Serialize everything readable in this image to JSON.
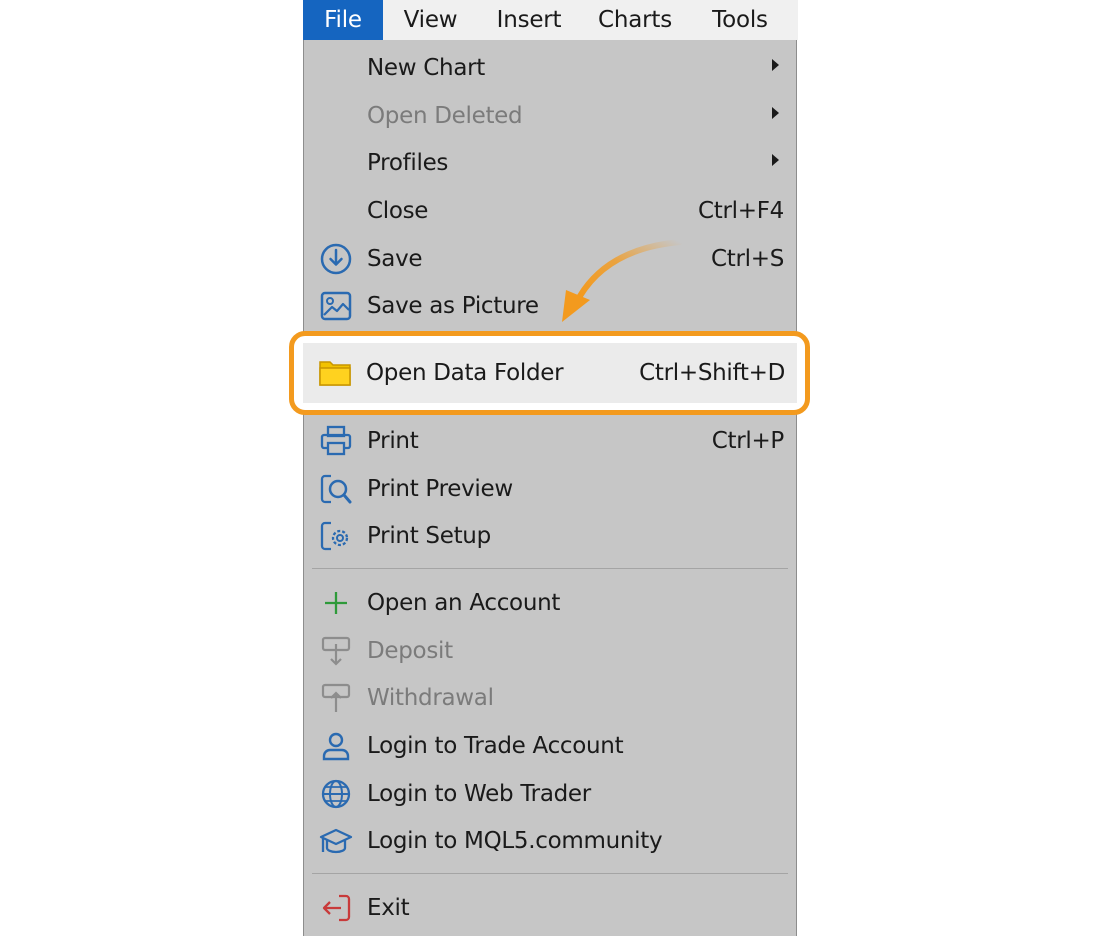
{
  "menubar": {
    "tabs": [
      {
        "label": "File",
        "active": true
      },
      {
        "label": "View"
      },
      {
        "label": "Insert"
      },
      {
        "label": "Charts"
      },
      {
        "label": "Tools"
      }
    ]
  },
  "file_menu": {
    "items": [
      {
        "label": "New Chart",
        "submenu": true
      },
      {
        "label": "Open Deleted",
        "submenu": true,
        "disabled": true
      },
      {
        "label": "Profiles",
        "submenu": true
      },
      {
        "label": "Close",
        "shortcut": "Ctrl+F4"
      },
      {
        "label": "Save",
        "shortcut": "Ctrl+S",
        "icon": "save-icon"
      },
      {
        "label": "Save as Picture",
        "icon": "picture-icon"
      },
      {
        "label": "Open Data Folder",
        "shortcut": "Ctrl+Shift+D",
        "icon": "folder-icon",
        "highlighted": true
      },
      {
        "label": "Print",
        "shortcut": "Ctrl+P",
        "icon": "printer-icon"
      },
      {
        "label": "Print Preview",
        "icon": "print-preview-icon"
      },
      {
        "label": "Print Setup",
        "icon": "print-setup-icon"
      },
      {
        "label": "Open an Account",
        "icon": "plus-icon"
      },
      {
        "label": "Deposit",
        "icon": "deposit-icon",
        "disabled": true
      },
      {
        "label": "Withdrawal",
        "icon": "withdrawal-icon",
        "disabled": true
      },
      {
        "label": "Login to Trade Account",
        "icon": "user-icon"
      },
      {
        "label": "Login to Web Trader",
        "icon": "globe-icon"
      },
      {
        "label": "Login to MQL5.community",
        "icon": "graduation-cap-icon"
      },
      {
        "label": "Exit",
        "icon": "exit-icon"
      }
    ]
  },
  "colors": {
    "active_tab": "#1565c0",
    "menu_background": "#c6c6c6",
    "highlight_border": "#f39a1e",
    "disabled_text": "#7b7b7b",
    "icon_blue": "#2a6ab1",
    "folder_yellow": "#f2c200",
    "plus_green": "#2e9a3a",
    "exit_red": "#c83a3a"
  }
}
